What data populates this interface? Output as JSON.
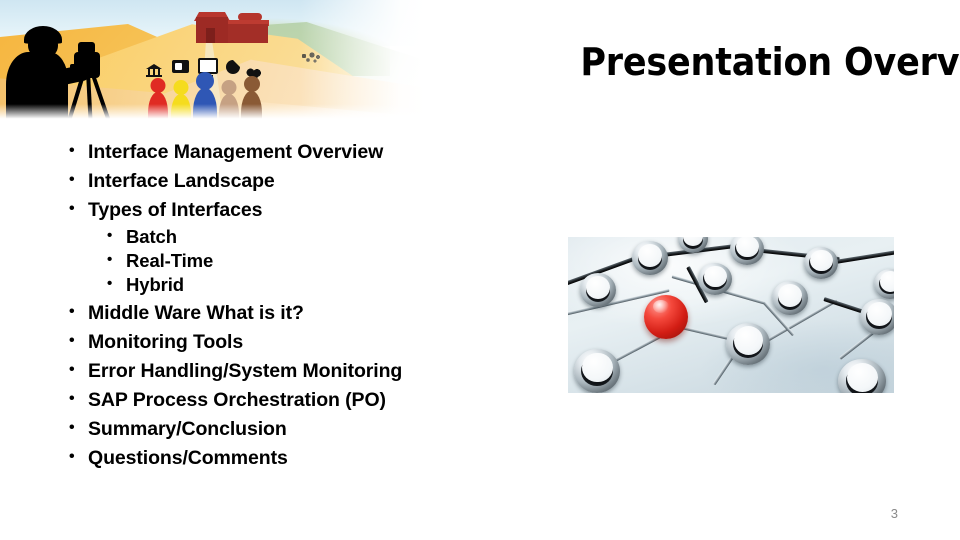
{
  "slide": {
    "title": "Presentation Overview",
    "page_number": "3"
  },
  "outline": [
    {
      "label": "Interface Management Overview",
      "children": []
    },
    {
      "label": "Interface Landscape",
      "children": []
    },
    {
      "label": "Types of Interfaces",
      "children": [
        "Batch",
        "Real-Time",
        "Hybrid"
      ]
    },
    {
      "label": "Middle Ware What is it?",
      "children": []
    },
    {
      "label": "Monitoring Tools",
      "children": []
    },
    {
      "label": "Error Handling/System Monitoring",
      "children": []
    },
    {
      "label": "SAP Process Orchestration (PO)",
      "children": []
    },
    {
      "label": "Summary/Conclusion",
      "children": []
    },
    {
      "label": "Questions/Comments",
      "children": []
    }
  ],
  "header_banner": {
    "description": "Illustration banner: silhouetted photographer with tripod camera on amber dunes, red barn on green hill, five colored people figures beneath bank, camera, monitor, pie-chart and gear icons",
    "sky_color": "#cfe6f2",
    "dune_color": "#f6b53e",
    "barn_color": "#9d2a24",
    "figure_colors": [
      "#e02b23",
      "#f5dc1e",
      "#2f57b5",
      "#c6a183",
      "#8a5a35"
    ]
  },
  "network_image": {
    "description": "3D render of chrome ring-nodes connected by metal rods on a pale blue surface, with one highlighted red sphere",
    "highlight_color": "#d21d14",
    "background_color": "#dfe9ee"
  }
}
